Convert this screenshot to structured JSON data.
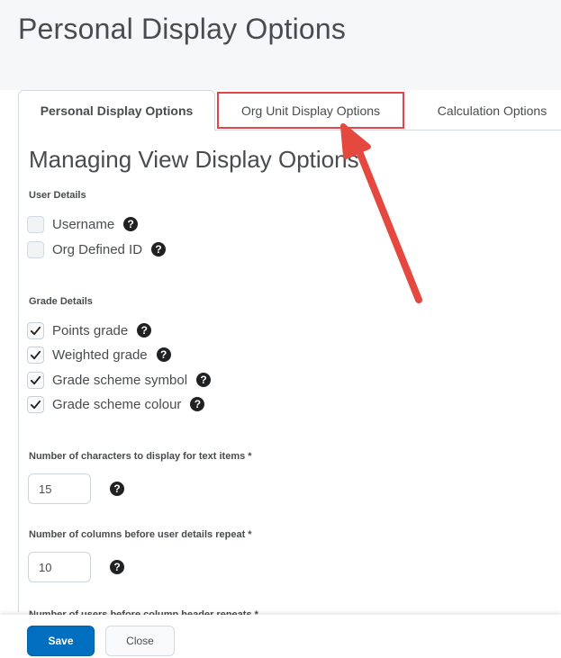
{
  "page": {
    "title": "Personal Display Options"
  },
  "tabs": [
    {
      "label": "Personal Display Options",
      "active": true
    },
    {
      "label": "Org Unit Display Options",
      "highlighted": true
    },
    {
      "label": "Calculation Options"
    }
  ],
  "main": {
    "heading": "Managing View Display Options",
    "user_details": {
      "label": "User Details",
      "options": [
        {
          "label": "Username",
          "checked": false
        },
        {
          "label": "Org Defined ID",
          "checked": false
        }
      ]
    },
    "grade_details": {
      "label": "Grade Details",
      "options": [
        {
          "label": "Points grade",
          "checked": true
        },
        {
          "label": "Weighted grade",
          "checked": true
        },
        {
          "label": "Grade scheme symbol",
          "checked": true
        },
        {
          "label": "Grade scheme colour",
          "checked": true
        }
      ]
    },
    "text_chars": {
      "label": "Number of characters to display for text items *",
      "value": "15"
    },
    "columns_repeat": {
      "label": "Number of columns before user details repeat *",
      "value": "10"
    },
    "users_repeat": {
      "label": "Number of users before column header repeats *"
    }
  },
  "footer": {
    "save_label": "Save",
    "close_label": "Close"
  },
  "help_glyph": "?",
  "colors": {
    "primary": "#006fbf",
    "highlight": "#e0474c",
    "text": "#494c4e"
  },
  "icons": {
    "check": "checkmark-icon",
    "help": "help-icon",
    "arrow": "arrow-annotation"
  }
}
